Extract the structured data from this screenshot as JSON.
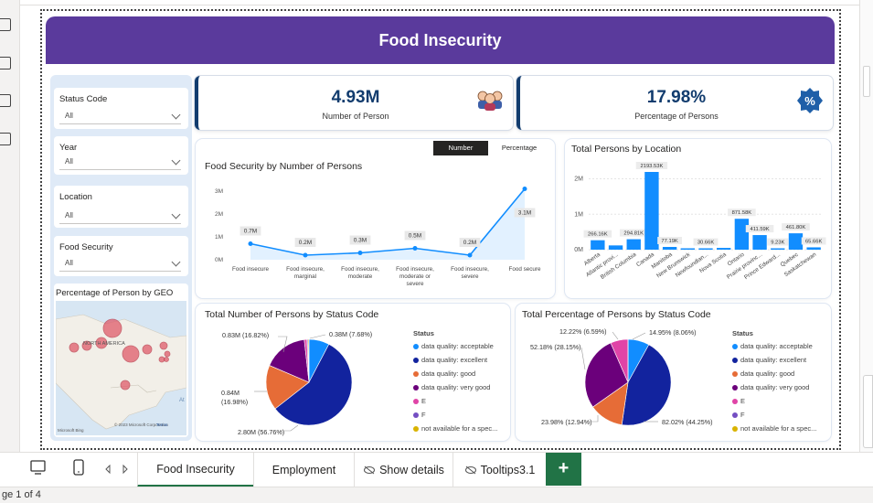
{
  "report": {
    "title": "Food Insecurity",
    "status": "ge 1 of 4"
  },
  "filters": [
    {
      "label": "Status Code",
      "value": "All"
    },
    {
      "label": "Year",
      "value": "All"
    },
    {
      "label": "Location",
      "value": "All"
    },
    {
      "label": "Food Security",
      "value": "All"
    }
  ],
  "map": {
    "title": "Percentage of Person by GEO",
    "region_label": "NORTH AMERICA",
    "copyright": "© 2023 Microsoft Corporation",
    "terms": "Terms",
    "logo": "Microsoft Bing",
    "edge_label": "At"
  },
  "kpis": [
    {
      "value": "4.93M",
      "label": "Number of Person",
      "icon": "people-icon"
    },
    {
      "value": "17.98%",
      "label": "Percentage of Persons",
      "icon": "percent-badge-icon"
    }
  ],
  "toggle": {
    "number": "Number",
    "percentage": "Percentage"
  },
  "colors": {
    "banner": "#5a3a9c",
    "accent": "#118dff",
    "acceptable": "#118dff",
    "excellent": "#12239e",
    "good": "#e66c37",
    "very_good": "#6b007b",
    "E": "#e044a7",
    "F": "#744ec2",
    "not_available": "#d9b300"
  },
  "chart_data": [
    {
      "type": "area",
      "title": "Food Security by Number of Persons",
      "categories": [
        "Food insecure",
        "Food insecure, marginal",
        "Food insecure, moderate",
        "Food insecure, moderate or severe",
        "Food insecure, severe",
        "Food secure"
      ],
      "category_lines": [
        [
          "Food insecure"
        ],
        [
          "Food insecure,",
          "marginal"
        ],
        [
          "Food insecure,",
          "moderate"
        ],
        [
          "Food insecure,",
          "moderate or",
          "severe"
        ],
        [
          "Food insecure,",
          "severe"
        ],
        [
          "Food secure"
        ]
      ],
      "values": [
        0.7,
        0.2,
        0.3,
        0.5,
        0.2,
        3.1
      ],
      "data_labels": [
        "0.7M",
        "0.2M",
        "0.3M",
        "0.5M",
        "0.2M",
        "3.1M"
      ],
      "yticks": [
        "0M",
        "1M",
        "2M",
        "3M"
      ],
      "ylim": [
        0,
        3.2
      ]
    },
    {
      "type": "bar",
      "title": "Total Persons by Location",
      "categories": [
        "Alberta",
        "Atlantic provi...",
        "British Columbia",
        "Canada",
        "Manitoba",
        "New Brunswick",
        "Newfoundlan...",
        "Nova Scotia",
        "Ontario",
        "Prairie provinc...",
        "Prince Edward...",
        "Quebec",
        "Saskatchewan"
      ],
      "values": [
        266.16,
        120,
        294.81,
        2193.53,
        77.19,
        35,
        30.66,
        50,
        871.58,
        411.59,
        9.23,
        461.8,
        65.66
      ],
      "data_labels": [
        "266.16K",
        "",
        "294.81K",
        "2193.53K",
        "77.19K",
        "",
        "30.66K",
        "",
        "871.58K",
        "411.59K",
        "9.23K",
        "461.80K",
        "65.66K"
      ],
      "yticks": [
        "0M",
        "1M",
        "2M"
      ],
      "ylim": [
        0,
        2400
      ]
    },
    {
      "type": "pie",
      "title": "Total Number of Persons by Status Code",
      "legend_title": "Status",
      "series": [
        {
          "name": "data quality: acceptable",
          "value": 7.68,
          "label": "0.38M (7.68%)"
        },
        {
          "name": "data quality: excellent",
          "value": 56.76,
          "label": "2.80M (56.76%)"
        },
        {
          "name": "data quality: good",
          "value": 16.98,
          "label": "0.84M (16.98%)"
        },
        {
          "name": "data quality: very good",
          "value": 16.82,
          "label": "0.83M (16.82%)"
        },
        {
          "name": "E",
          "value": 1.0,
          "label": ""
        },
        {
          "name": "F",
          "value": 0.4,
          "label": ""
        },
        {
          "name": "not available for a spec...",
          "value": 0.36,
          "label": ""
        }
      ]
    },
    {
      "type": "pie",
      "title": "Total Percentage of Persons by Status Code",
      "legend_title": "Status",
      "series": [
        {
          "name": "data quality: acceptable",
          "value": 8.06,
          "label": "14.95% (8.06%)"
        },
        {
          "name": "data quality: excellent",
          "value": 44.25,
          "label": "82.02% (44.25%)"
        },
        {
          "name": "data quality: good",
          "value": 12.94,
          "label": "23.98% (12.94%)"
        },
        {
          "name": "data quality: very good",
          "value": 28.15,
          "label": "52.18% (28.15%)"
        },
        {
          "name": "E",
          "value": 6.59,
          "label": "12.22% (6.59%)"
        },
        {
          "name": "F",
          "value": 0.01,
          "label": ""
        },
        {
          "name": "not available for a spec...",
          "value": 0.0,
          "label": ""
        }
      ]
    }
  ],
  "tabs": [
    {
      "label": "Food Insecurity",
      "active": true
    },
    {
      "label": "Employment",
      "active": false
    },
    {
      "label": "Show details",
      "active": false,
      "hidden": true
    },
    {
      "label": "Tooltips3.1",
      "active": false,
      "hidden": true
    }
  ],
  "add_tab": "+"
}
